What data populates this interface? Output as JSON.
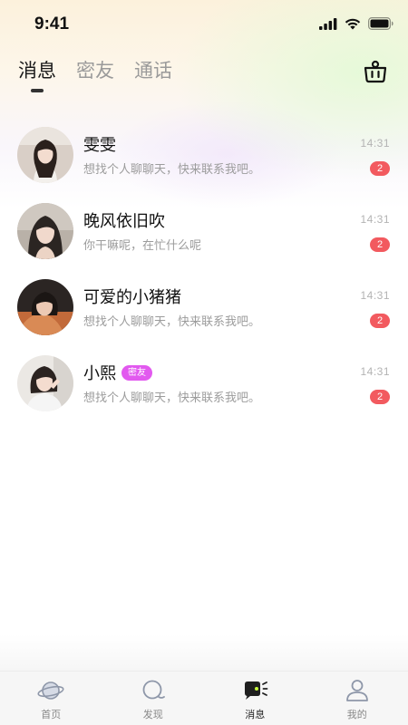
{
  "status_bar": {
    "time": "9:41"
  },
  "header": {
    "tabs": [
      {
        "label": "消息",
        "active": true
      },
      {
        "label": "密友",
        "active": false
      },
      {
        "label": "通话",
        "active": false
      }
    ],
    "action_icon": "basket-icon"
  },
  "conversations": [
    {
      "name": "雯雯",
      "preview": "想找个人聊聊天，快来联系我吧。",
      "time": "14:31",
      "unread": "2",
      "badge": ""
    },
    {
      "name": "晚风依旧吹",
      "preview": "你干嘛呢，在忙什么呢",
      "time": "14:31",
      "unread": "2",
      "badge": ""
    },
    {
      "name": "可爱的小猪猪",
      "preview": "想找个人聊聊天，快来联系我吧。",
      "time": "14:31",
      "unread": "2",
      "badge": ""
    },
    {
      "name": "小熙",
      "preview": "想找个人聊聊天，快来联系我吧。",
      "time": "14:31",
      "unread": "2",
      "badge": "密友"
    }
  ],
  "tabbar": {
    "items": [
      {
        "label": "首页",
        "icon": "planet-icon",
        "active": false
      },
      {
        "label": "发现",
        "icon": "discover-icon",
        "active": false
      },
      {
        "label": "消息",
        "icon": "message-icon",
        "active": true
      },
      {
        "label": "我的",
        "icon": "profile-icon",
        "active": false
      }
    ]
  },
  "colors": {
    "unread_badge": "#f25a5f",
    "friend_badge": "#e259ef",
    "active_text": "#1a1a1a",
    "inactive_text": "#9a9a9a"
  }
}
